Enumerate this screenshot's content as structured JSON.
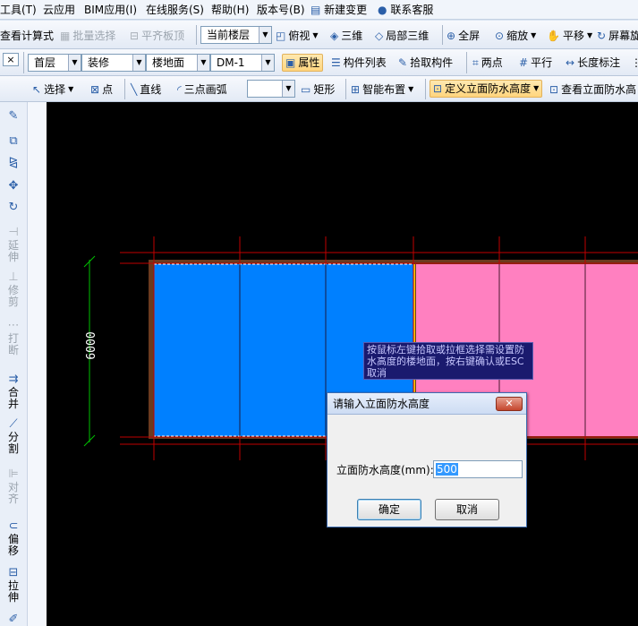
{
  "menu": [
    "工具(T)",
    "云应用",
    "BIM应用(I)",
    "在线服务(S)",
    "帮助(H)",
    "版本号(B)",
    "新建变更",
    "联系客服"
  ],
  "toolbar1": {
    "view_calc": "查看计算式",
    "batch_select": "批量选择",
    "flush_slab": "平齐板顶",
    "floor_scope": "当前楼层",
    "top_view": "俯视",
    "three_d": "三维",
    "local_3d": "局部三维",
    "full_screen": "全屏",
    "zoom": "缩放",
    "pan": "平移",
    "screen_rotate": "屏幕旋"
  },
  "toolbar2": {
    "close": "×",
    "floor": "首层",
    "category": "装修",
    "component_type": "楼地面",
    "component": "DM-1",
    "properties": "属性",
    "component_list": "构件列表",
    "pick_component": "拾取构件",
    "two_points": "两点",
    "parallel": "平行",
    "length_dim": "长度标注"
  },
  "toolbar3": {
    "select": "选择",
    "point": "点",
    "line": "直线",
    "arc": "三点画弧",
    "rect": "矩形",
    "smart_layout": "智能布置",
    "define_height": "定义立面防水高度",
    "view_height": "查看立面防水高"
  },
  "left_tools": [
    "延伸",
    "修剪",
    "打断",
    "合并",
    "分割",
    "对齐",
    "偏移",
    "拉伸"
  ],
  "canvas": {
    "dimension_label": "6000",
    "hint_text": "按鼠标左键拾取或拉框选择需设置防水高度的楼地面，按右键确认或ESC取消"
  },
  "dialog": {
    "title": "请输入立面防水高度",
    "field_label": "立面防水高度(mm):",
    "field_value": "500",
    "ok_label": "确定",
    "cancel_label": "取消"
  },
  "colors": {
    "floor_blue": "#0080ff",
    "floor_pink": "#ff80c0",
    "dimension_green": "#00c000",
    "axis_red": "#c00000",
    "wall_brown": "#6b3a1e"
  }
}
